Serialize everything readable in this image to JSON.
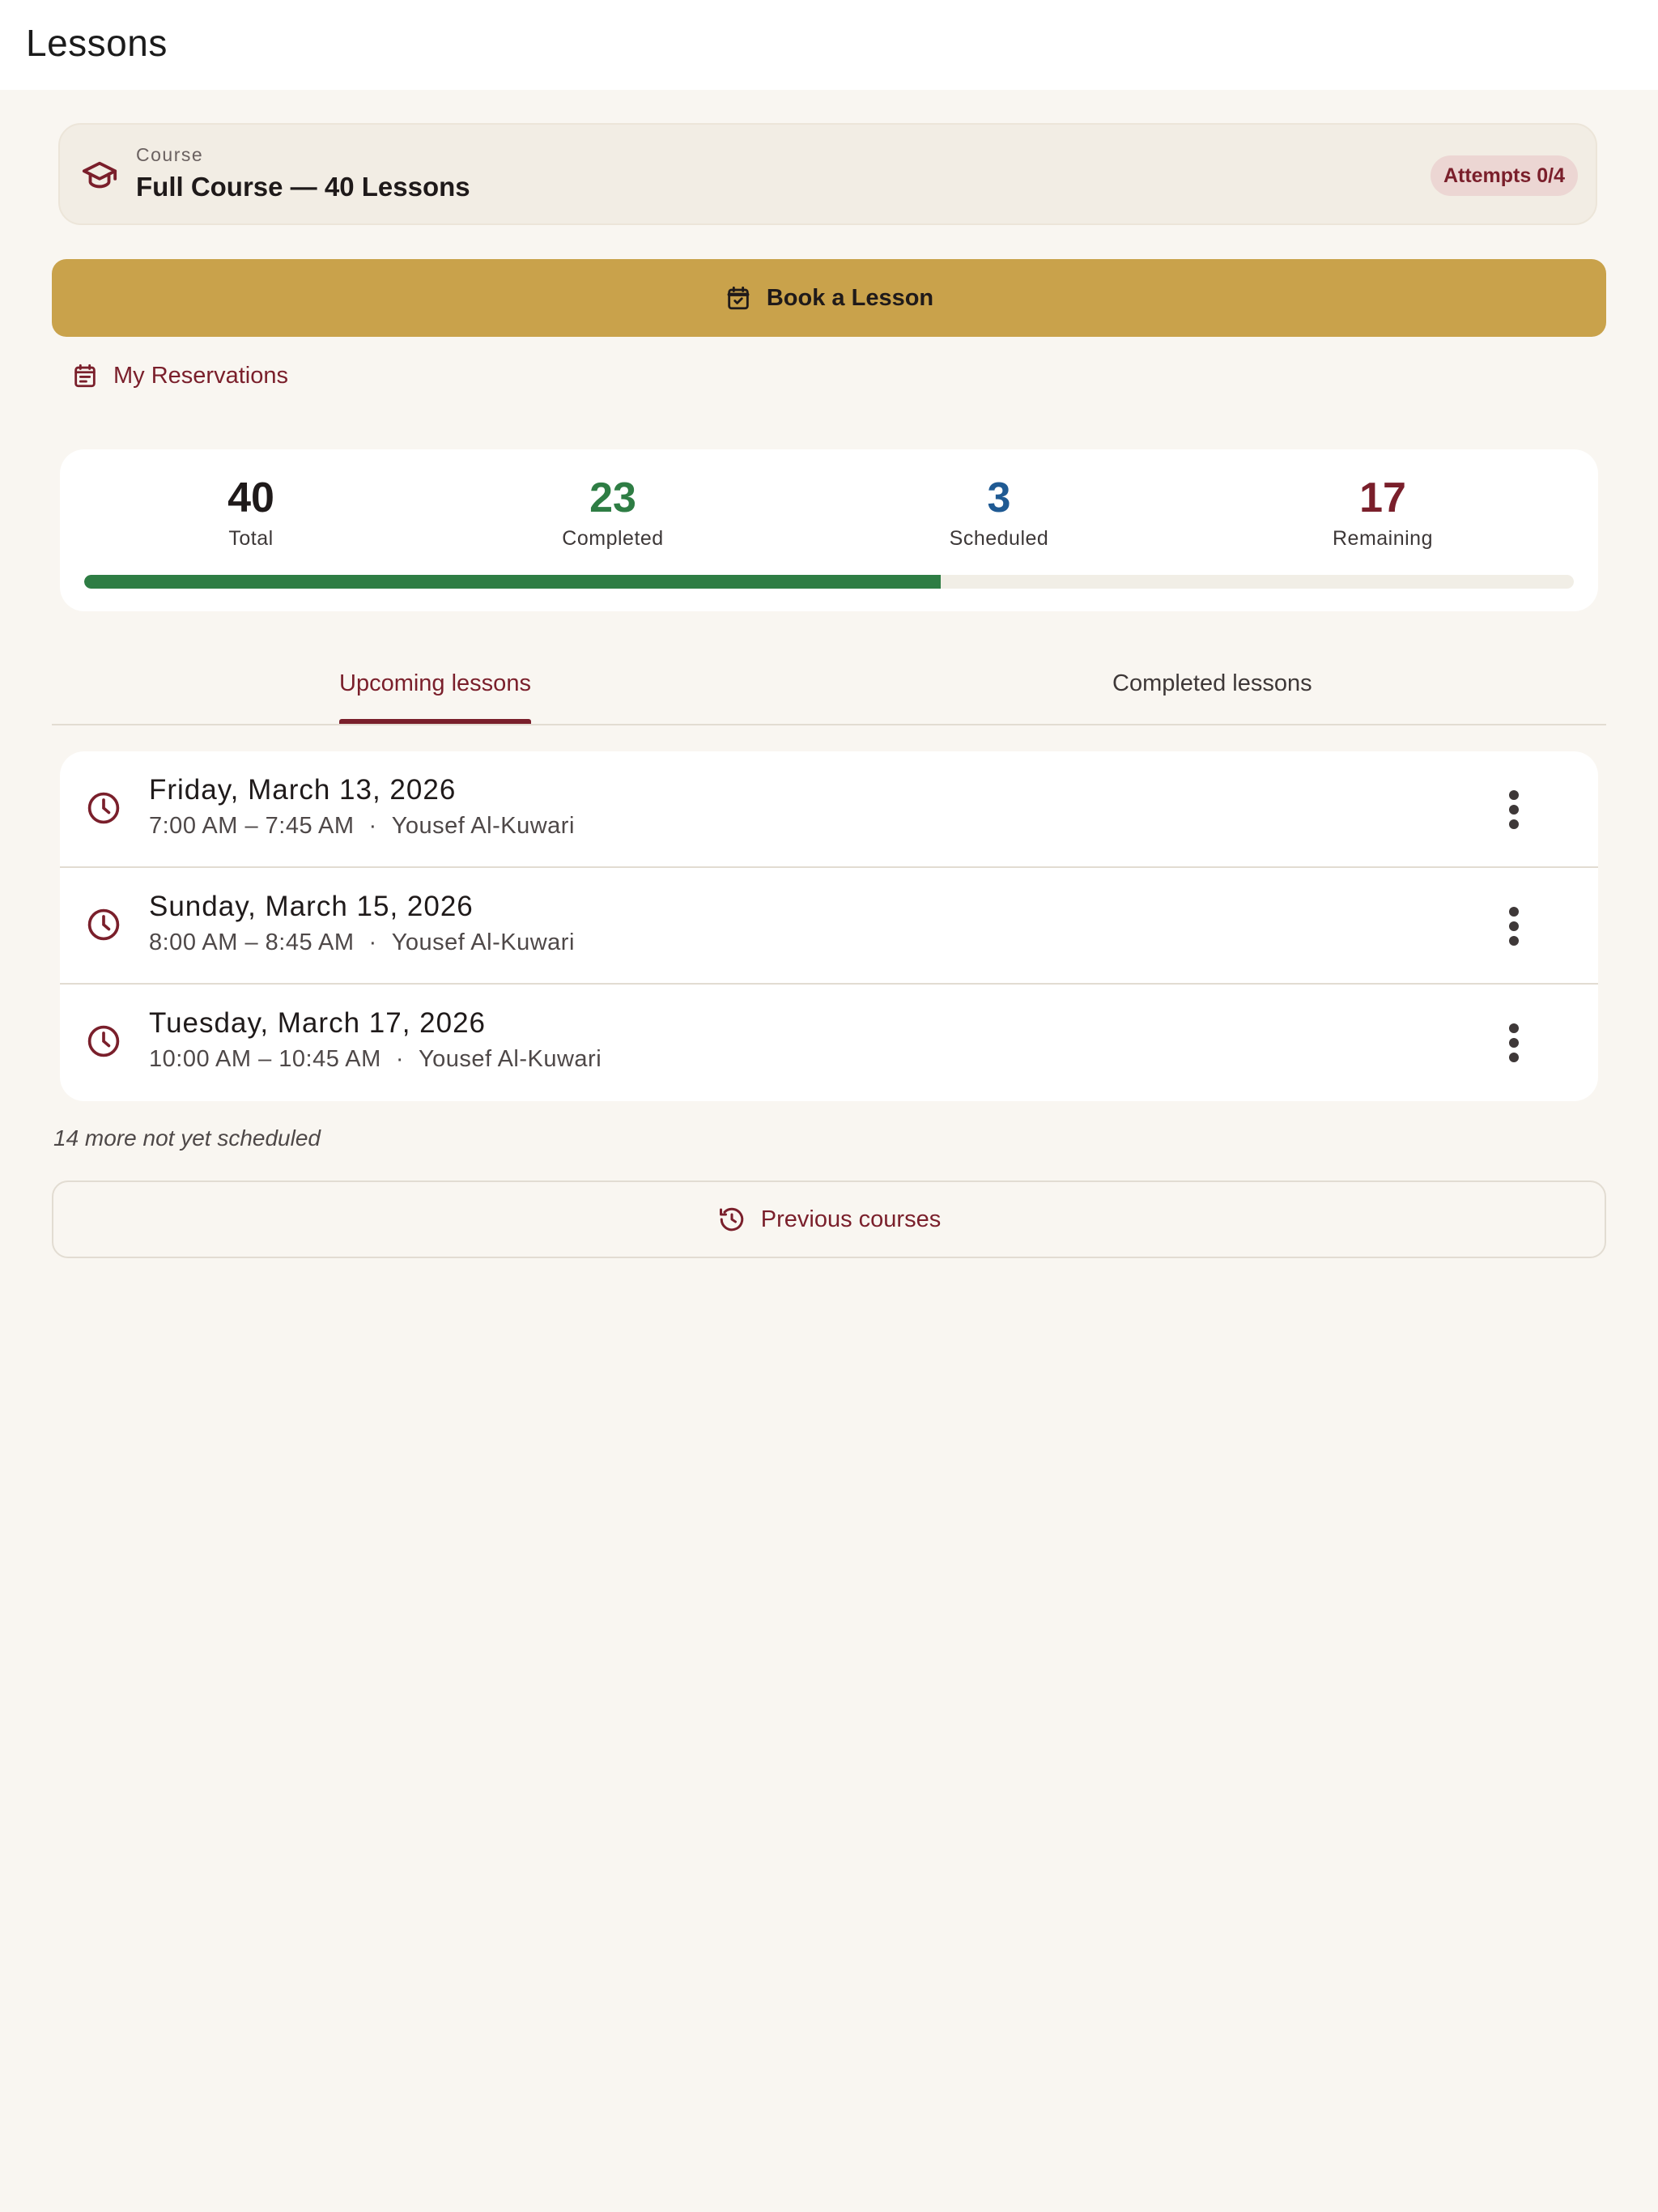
{
  "header": {
    "title": "Lessons"
  },
  "course": {
    "label": "Course",
    "name": "Full Course — 40 Lessons",
    "attempts": "Attempts 0/4",
    "icon": "graduation-cap-icon"
  },
  "actions": {
    "book_label": "Book a Lesson",
    "book_icon": "calendar-check-icon",
    "reservations_label": "My Reservations",
    "reservations_icon": "calendar-icon"
  },
  "stats": {
    "total": {
      "value": "40",
      "label": "Total",
      "color": "#1f1a1a"
    },
    "completed": {
      "value": "23",
      "label": "Completed",
      "color": "#2e7d44"
    },
    "scheduled": {
      "value": "3",
      "label": "Scheduled",
      "color": "#1f5a93"
    },
    "remaining": {
      "value": "17",
      "label": "Remaining",
      "color": "#7a1f2b"
    },
    "progress_fraction": 0.575
  },
  "tabs": [
    {
      "label": "Upcoming lessons",
      "active": true
    },
    {
      "label": "Completed lessons",
      "active": false
    }
  ],
  "lessons": [
    {
      "date": "Friday, March 13, 2026",
      "time": "7:00 AM – 7:45 AM",
      "instructor": "Yousef Al-Kuwari"
    },
    {
      "date": "Sunday, March 15, 2026",
      "time": "8:00 AM – 8:45 AM",
      "instructor": "Yousef Al-Kuwari"
    },
    {
      "date": "Tuesday, March 17, 2026",
      "time": "10:00 AM – 10:45 AM",
      "instructor": "Yousef Al-Kuwari"
    }
  ],
  "separator": "·",
  "not_scheduled": "14 more not yet scheduled",
  "previous_courses_label": "Previous courses",
  "colors": {
    "accent": "#7a1f2b",
    "gold": "#c9a24b",
    "background": "#f9f6f1"
  }
}
